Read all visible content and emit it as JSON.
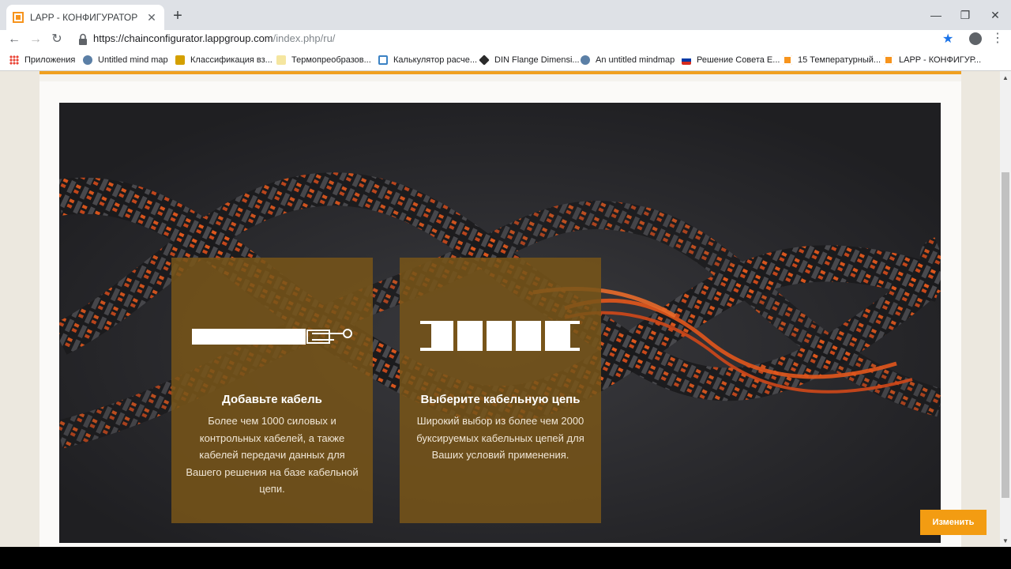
{
  "browser": {
    "tab_title": "LAPP - КОНФИГУРАТОР OLFLEX",
    "tab_close": "✕",
    "new_tab": "+",
    "url_domain": "https://chainconfigurator.lappgroup.com",
    "url_path": "/index.php/ru/",
    "back": "←",
    "forward": "→",
    "reload": "↻",
    "star": "★",
    "menu": "⋮",
    "minimize": "—",
    "maximize": "❐",
    "close": "✕"
  },
  "bookmarks": [
    {
      "label": "Приложения",
      "icon": "apps-grid-icon",
      "color": "#4285f4"
    },
    {
      "label": "Untitled mind map",
      "icon": "mindmap-icon",
      "color": "#5b7fa6"
    },
    {
      "label": "Классификация вз...",
      "icon": "ex-icon",
      "color": "#d4a000"
    },
    {
      "label": "Термопреобразов...",
      "icon": "folder-icon",
      "color": "#f5d76e"
    },
    {
      "label": "Калькулятор расче...",
      "icon": "calculator-icon",
      "color": "#3b82c4"
    },
    {
      "label": "DIN Flange Dimensi...",
      "icon": "din-icon",
      "color": "#2b2b2b"
    },
    {
      "label": "An untitled mindmap",
      "icon": "mindmap-icon",
      "color": "#5b7fa6"
    },
    {
      "label": "Решение Совета Е...",
      "icon": "flag-icon",
      "color": "#d52b1e"
    },
    {
      "label": "15 Температурный...",
      "icon": "lapp-icon",
      "color": "#f7941d"
    },
    {
      "label": "LAPP - КОНФИГУР...",
      "icon": "lapp-icon",
      "color": "#f7941d"
    }
  ],
  "cards": [
    {
      "title": "Добавьте кабель",
      "text": "Более чем 1000 силовых и контрольных кабелей, а также кабелей передачи данных для Вашего решения на базе кабельной цепи."
    },
    {
      "title": "Выберите кабельную цепь",
      "text": "Широкий выбор из более чем 2000 буксируемых кабельных цепей для Ваших условий применения."
    }
  ],
  "change_button": "Изменить",
  "colors": {
    "accent": "#f39c12",
    "card": "#78551a",
    "hero": "#2b2b2e"
  }
}
